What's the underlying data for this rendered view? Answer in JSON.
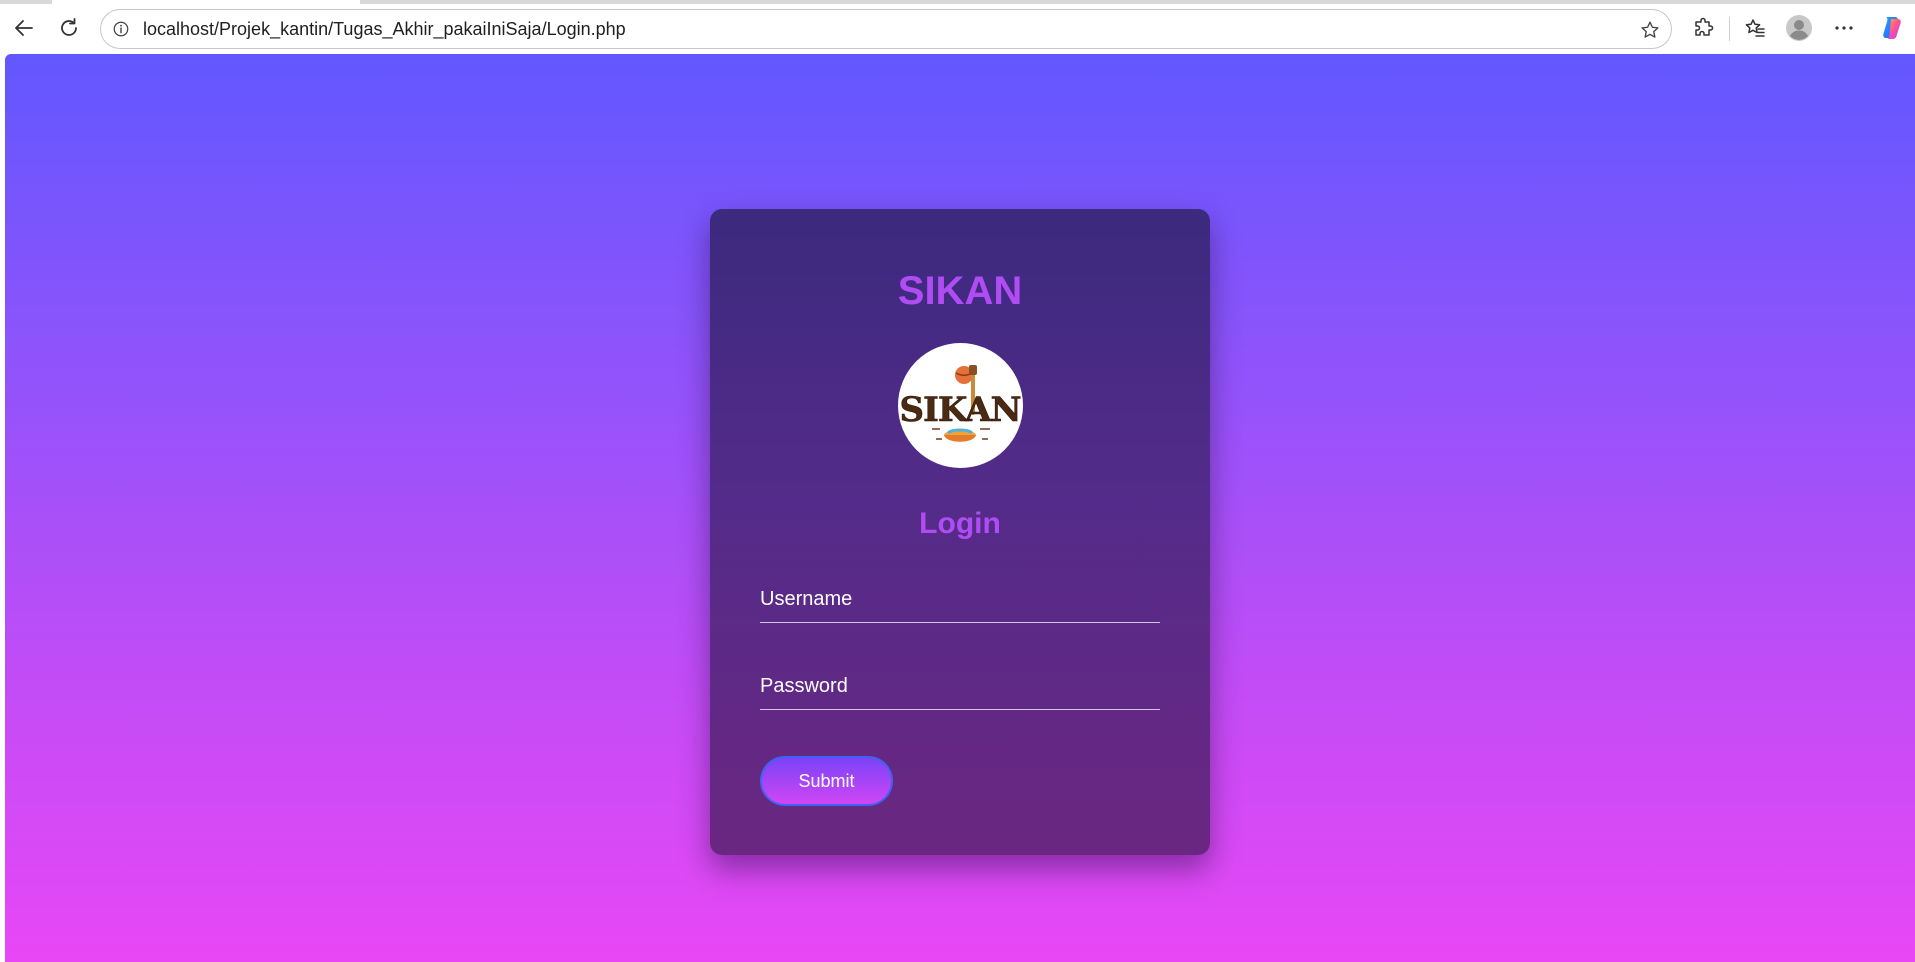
{
  "browser": {
    "url": "localhost/Projek_kantin/Tugas_Akhir_pakaiIniSaja/Login.php",
    "icons": [
      "back-arrow-icon",
      "reload-icon",
      "info-icon",
      "star-icon",
      "extensions-icon",
      "favorites-icon",
      "profile-icon",
      "more-icon",
      "copilot-icon"
    ]
  },
  "login_card": {
    "brand": "SIKAN",
    "logo_text": "SIKAN",
    "heading": "Login",
    "username_placeholder": "Username",
    "password_placeholder": "Password",
    "submit_label": "Submit"
  },
  "colors": {
    "page_gradient_top": "#6257fe",
    "page_gradient_bottom": "#e847f6",
    "card_top": "#3b2a7e",
    "card_bottom": "#6a2781",
    "title_color": "#b04cf4",
    "button_border": "#3f63f0"
  }
}
